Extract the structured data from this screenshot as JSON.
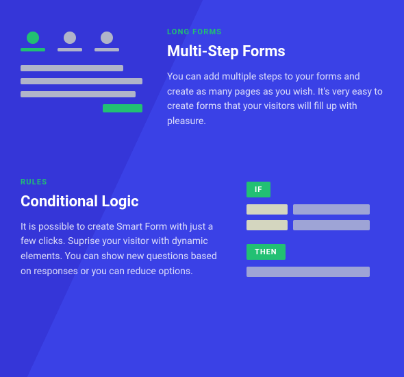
{
  "feature1": {
    "eyebrow": "LONG FORMS",
    "heading": "Multi-Step Forms",
    "body": "You can add multiple steps to your forms and create as many pages as you wish. It's very easy to create forms that your visitors will fill up with pleasure."
  },
  "feature2": {
    "eyebrow": "RULES",
    "heading": "Conditional Logic",
    "body": "It is possible to create Smart Form with just a few clicks. Suprise your visitor with dynamic elements. You can show new questions based on responses or you can reduce options.",
    "if_label": "IF",
    "then_label": "THEN"
  }
}
